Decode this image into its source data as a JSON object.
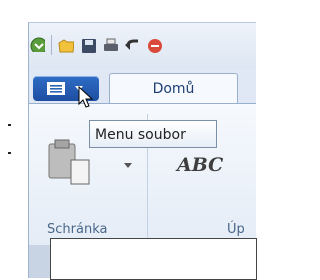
{
  "app": {
    "quick_access_icons": [
      "app-round-icon",
      "folder-icon",
      "save-icon",
      "print-icon",
      "undo-icon",
      "redo-icon"
    ],
    "menu_button": {
      "icon": "list-menu-icon",
      "arrow": "triangle-down-icon",
      "tooltip": "Menu soubor"
    },
    "tabs": [
      {
        "label": "Domů",
        "selected": true
      }
    ],
    "groups": [
      {
        "label": "Schránka"
      },
      {
        "label": "Úp"
      }
    ],
    "ribbon_text": "ABC",
    "colors": {
      "menu_button": "#2a63b8",
      "tab_text": "#1e3f73",
      "group_label": "#4b6889"
    }
  }
}
